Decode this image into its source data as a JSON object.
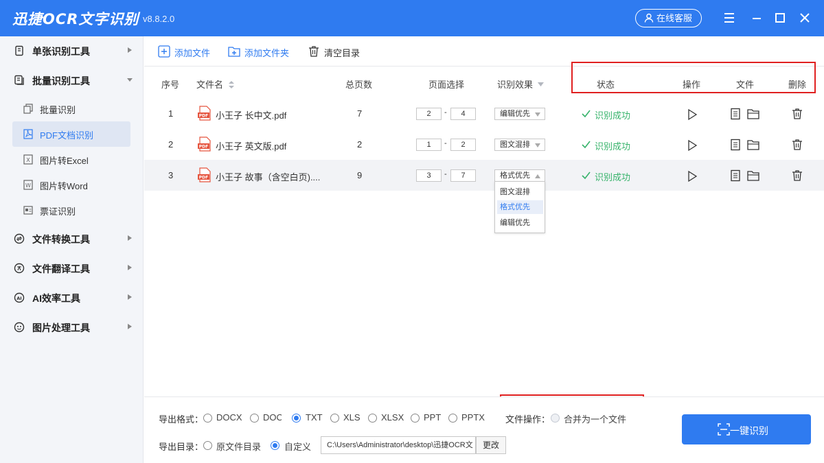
{
  "app": {
    "title": "迅捷OCR文字识别",
    "version": "v8.8.2.0",
    "service_label": "在线客服"
  },
  "sidebar": {
    "groups": [
      {
        "label": "单张识别工具",
        "icon": "single-doc-icon"
      },
      {
        "label": "批量识别工具",
        "icon": "batch-doc-icon",
        "expanded": true
      },
      {
        "label": "文件转换工具",
        "icon": "convert-icon"
      },
      {
        "label": "文件翻译工具",
        "icon": "translate-icon"
      },
      {
        "label": "AI效率工具",
        "icon": "ai-icon"
      },
      {
        "label": "图片处理工具",
        "icon": "image-process-icon"
      }
    ],
    "items": [
      {
        "label": "批量识别",
        "icon": "batch-icon"
      },
      {
        "label": "PDF文档识别",
        "icon": "pdf-icon",
        "active": true
      },
      {
        "label": "图片转Excel",
        "icon": "excel-icon"
      },
      {
        "label": "图片转Word",
        "icon": "word-icon"
      },
      {
        "label": "票证识别",
        "icon": "ticket-icon"
      }
    ]
  },
  "toolbar": {
    "add_file": "添加文件",
    "add_folder": "添加文件夹",
    "clear": "清空目录"
  },
  "table": {
    "headers": {
      "index": "序号",
      "name": "文件名",
      "pages": "总页数",
      "page_select": "页面选择",
      "effect": "识别效果",
      "status": "状态",
      "action": "操作",
      "file": "文件",
      "delete": "删除"
    },
    "rows": [
      {
        "index": "1",
        "name": "小王子 长中文.pdf",
        "pages": "7",
        "from": "2",
        "to": "4",
        "effect": "编辑优先",
        "status": "识别成功"
      },
      {
        "index": "2",
        "name": "小王子 英文版.pdf",
        "pages": "2",
        "from": "1",
        "to": "2",
        "effect": "图文混排",
        "status": "识别成功"
      },
      {
        "index": "3",
        "name": "小王子 故事（含空白页)....",
        "pages": "9",
        "from": "3",
        "to": "7",
        "effect": "格式优先",
        "status": "识别成功"
      }
    ],
    "dropdown_options": [
      "图文混排",
      "格式优先",
      "编辑优先"
    ],
    "dropdown_selected": "格式优先"
  },
  "export": {
    "format_label": "导出格式：",
    "formats": [
      "DOCX",
      "DOC",
      "TXT",
      "XLS",
      "XLSX",
      "PPT",
      "PPTX"
    ],
    "selected_format": "TXT",
    "file_op_label": "文件操作：",
    "merge_label": "合并为一个文件",
    "dir_label": "导出目录：",
    "dir_options": [
      "原文件目录",
      "自定义"
    ],
    "selected_dir": "自定义",
    "path": "C:\\Users\\Administrator\\desktop\\迅捷OCR文",
    "change_label": "更改",
    "start_label": "一键识别"
  },
  "colors": {
    "brand": "#2f7bf0",
    "success": "#37b36b",
    "highlight_box": "#e02020"
  }
}
